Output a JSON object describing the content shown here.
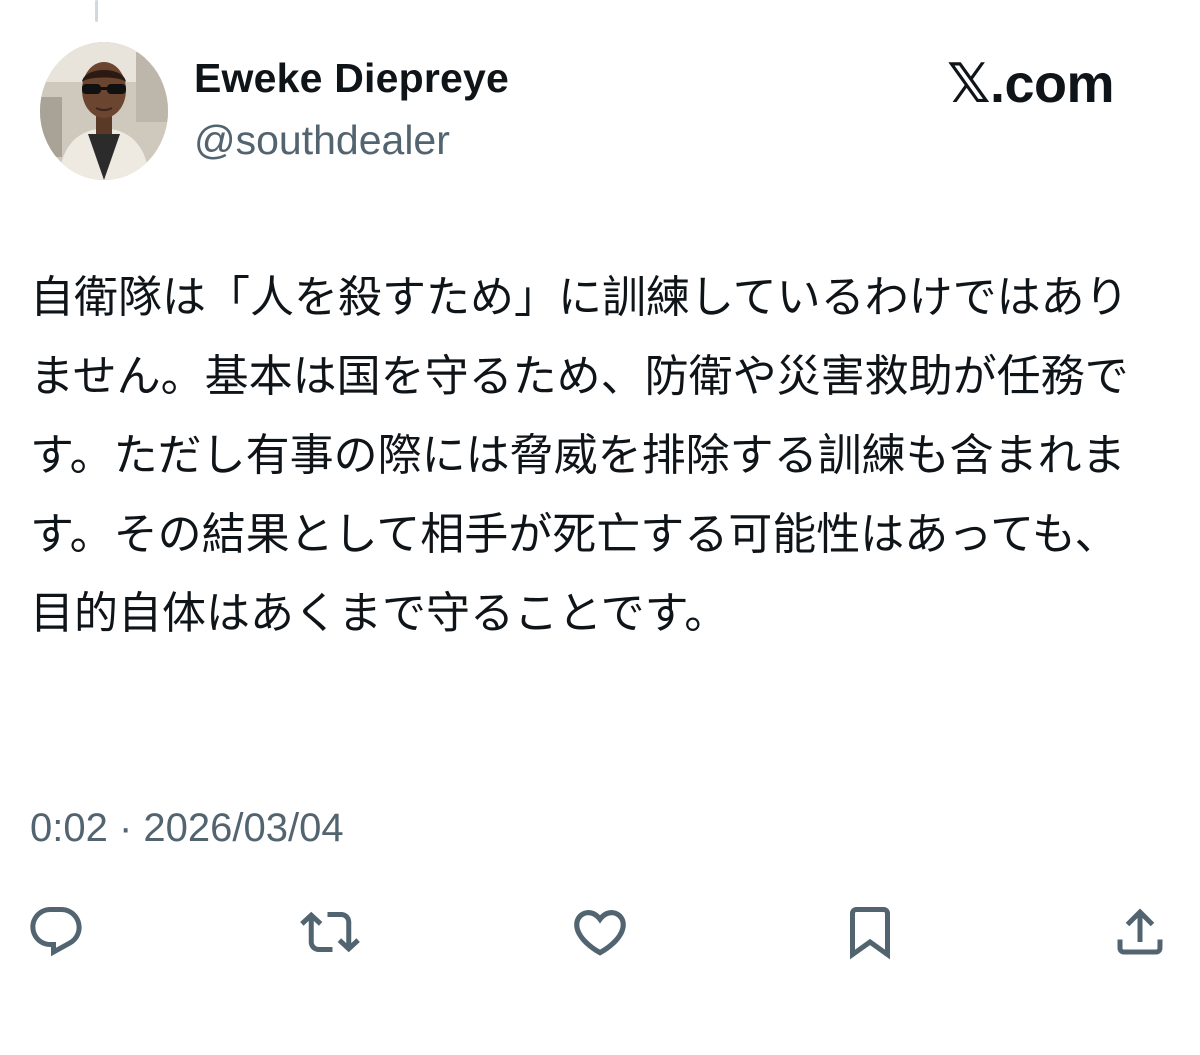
{
  "author": {
    "display_name": "Eweke Diepreye",
    "handle": "@southdealer",
    "avatar_icon": "profile-photo"
  },
  "brand": {
    "label": "𝕏.com"
  },
  "tweet": {
    "text": "自衛隊は「人を殺すため」に訓練しているわけではありません。基本は国を守るため、防衛や災害救助が任務です。ただし有事の際には脅威を排除する訓練も含まれます。その結果として相手が死亡する可能性はあっても、目的自体はあくまで守ることです。",
    "timestamp": "0:02 · 2026/03/04"
  },
  "actions": [
    {
      "name": "reply",
      "icon": "reply-icon"
    },
    {
      "name": "retweet",
      "icon": "retweet-icon"
    },
    {
      "name": "like",
      "icon": "heart-icon"
    },
    {
      "name": "bookmark",
      "icon": "bookmark-icon"
    },
    {
      "name": "share",
      "icon": "share-icon"
    }
  ],
  "colors": {
    "text_primary": "#0f1419",
    "text_secondary": "#536471",
    "icon": "#536471",
    "background": "#ffffff"
  }
}
